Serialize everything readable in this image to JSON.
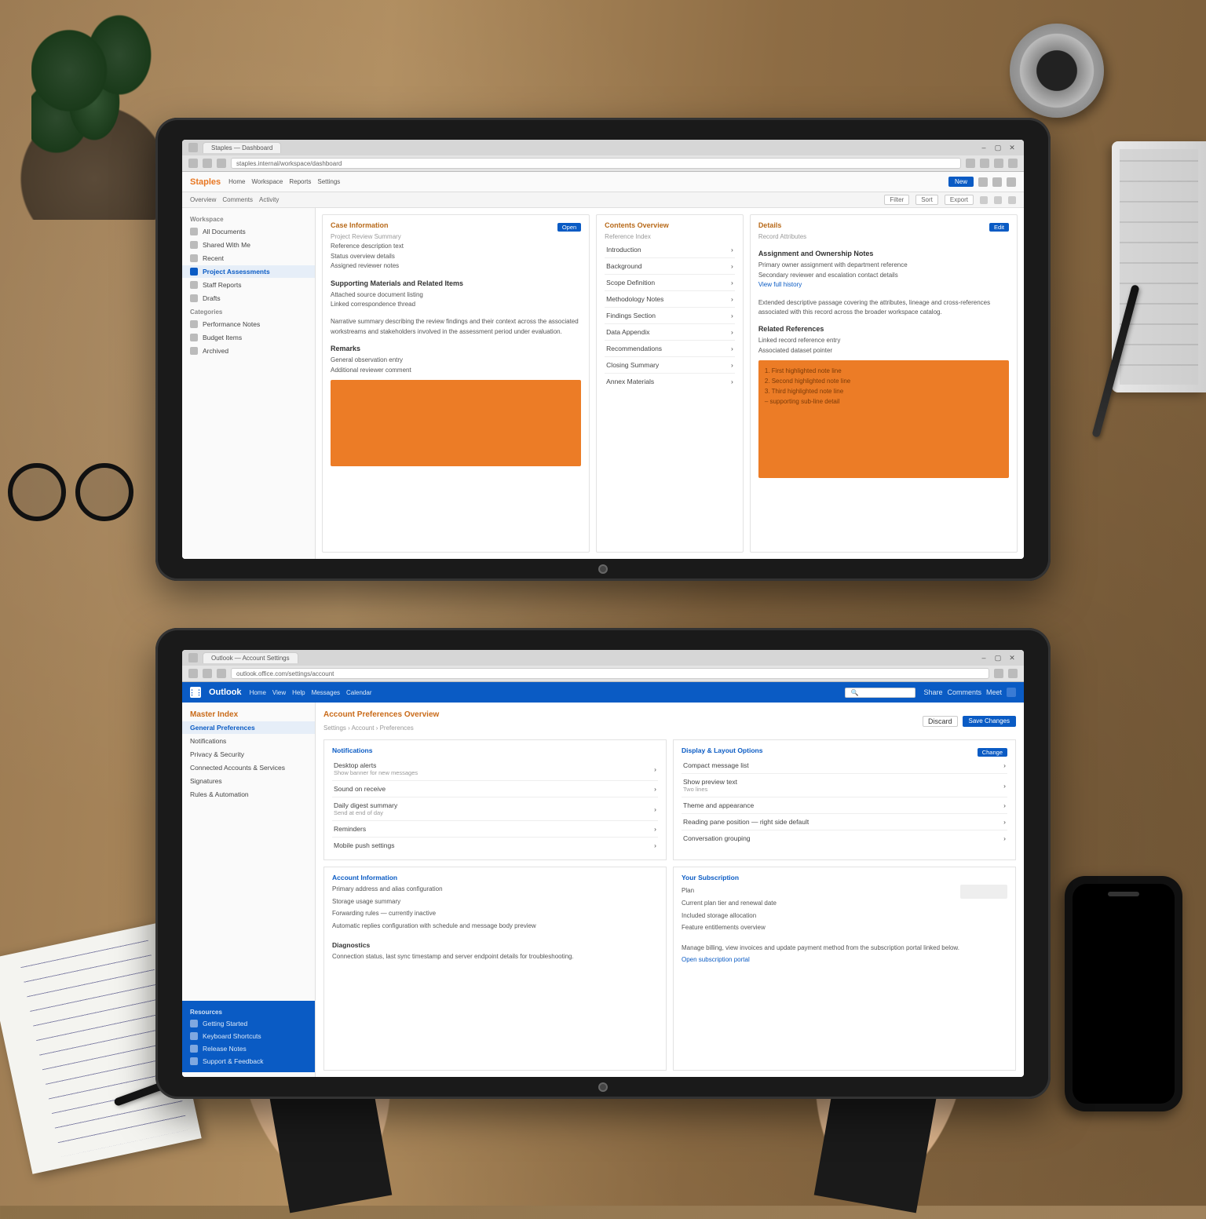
{
  "colors": {
    "orange": "#ec7c26",
    "blue": "#0a5bc4"
  },
  "deviceTop": {
    "browser": {
      "tab": "Staples — Dashboard",
      "url": "staples.internal/workspace/dashboard",
      "title": "Staples Workspace"
    },
    "brand": "Staples",
    "toolbar": [
      "Home",
      "Workspace",
      "Reports",
      "Settings"
    ],
    "toolbar2": {
      "items": [
        "Overview",
        "Comments",
        "Activity"
      ],
      "rightItems": [
        "Filter",
        "Sort",
        "Export"
      ]
    },
    "headerButton": "New",
    "sidebar": {
      "section1": "Workspace",
      "items1": [
        "All Documents",
        "Shared With Me",
        "Recent",
        "Project Assessments",
        "Staff Reports",
        "Drafts"
      ],
      "section2": "Categories",
      "items2": [
        "Performance Notes",
        "Budget Items",
        "Archived"
      ]
    },
    "col1": {
      "title": "Case Information",
      "sub": "Project Review Summary",
      "rows": [
        "Reference description text",
        "Status overview details",
        "Assigned reviewer notes"
      ],
      "button": "Open",
      "heading2": "Supporting Materials and Related Items",
      "bullets": [
        "Attached source document listing",
        "Linked correspondence thread"
      ],
      "para": "Narrative summary describing the review findings and their context across the associated workstreams and stakeholders involved in the assessment period under evaluation.",
      "heading3": "Remarks",
      "remarks": [
        "General observation entry",
        "Additional reviewer comment"
      ],
      "orangeLines": ""
    },
    "col2": {
      "title": "Contents Overview",
      "sub": "Reference Index",
      "items": [
        "Introduction",
        "Background",
        "Scope Definition",
        "Methodology Notes",
        "Findings Section",
        "Data Appendix",
        "Recommendations",
        "Closing Summary",
        "Annex Materials"
      ]
    },
    "col3": {
      "title": "Details",
      "sub": "Record Attributes",
      "button": "Edit",
      "heading2": "Assignment and Ownership Notes",
      "rows": [
        "Primary owner assignment with department reference",
        "Secondary reviewer and escalation contact details"
      ],
      "link": "View full history",
      "para": "Extended descriptive passage covering the attributes, lineage and cross-references associated with this record across the broader workspace catalog.",
      "heading3": "Related References",
      "refs": [
        "Linked record reference entry",
        "Associated dataset pointer"
      ],
      "orangeLines": [
        "1. First highlighted note line",
        "2. Second highlighted note line",
        "3. Third highlighted note line",
        "   – supporting sub-line detail"
      ]
    }
  },
  "deviceBottom": {
    "browser": {
      "tab": "Outlook — Account Settings",
      "url": "outlook.office.com/settings/account",
      "title": "Outlook Settings"
    },
    "brand": "Outlook",
    "toolbar": [
      "Home",
      "View",
      "Help",
      "Messages",
      "Calendar"
    ],
    "searchPlaceholder": "Search",
    "headerRight": [
      "Share",
      "Comments",
      "Meet"
    ],
    "pageTitle": "Account Preferences Overview",
    "breadcrumb": "Settings › Account › Preferences",
    "actionPrimary": "Save Changes",
    "actionSecondary": "Discard",
    "sidebar": {
      "title": "Master Index",
      "active": "General Preferences",
      "items": [
        "General Preferences",
        "Notifications",
        "Privacy & Security",
        "Connected Accounts & Services",
        "Signatures",
        "Rules & Automation"
      ],
      "blueTitle": "Resources",
      "blueItems": [
        "Getting Started",
        "Keyboard Shortcuts",
        "Release Notes",
        "Support & Feedback"
      ]
    },
    "upper": {
      "left": {
        "title": "Notifications",
        "items": [
          {
            "label": "Desktop alerts",
            "sub": "Show banner for new messages"
          },
          {
            "label": "Sound on receive",
            "sub": ""
          },
          {
            "label": "Daily digest summary",
            "sub": "Send at end of day"
          },
          {
            "label": "Reminders",
            "sub": ""
          },
          {
            "label": "Mobile push settings",
            "sub": ""
          }
        ]
      },
      "right": {
        "title": "Display & Layout Options",
        "items": [
          {
            "label": "Compact message list",
            "sub": ""
          },
          {
            "label": "Show preview text",
            "sub": "Two lines"
          },
          {
            "label": "Theme and appearance",
            "sub": ""
          },
          {
            "label": "Reading pane position — right side default",
            "sub": ""
          },
          {
            "label": "Conversation grouping",
            "sub": ""
          }
        ],
        "button": "Change"
      }
    },
    "lower": {
      "left": {
        "title": "Account Information",
        "rows": [
          "Primary address and alias configuration",
          "Storage usage summary",
          "Forwarding rules — currently inactive",
          "Automatic replies configuration with schedule and message body preview"
        ],
        "heading2": "Diagnostics",
        "diag": "Connection status, last sync timestamp and server endpoint details for troubleshooting."
      },
      "right": {
        "title": "Your Subscription",
        "rowLabel": "Plan",
        "rows": [
          "Current plan tier and renewal date",
          "Included storage allocation",
          "Feature entitlements overview"
        ],
        "para": "Manage billing, view invoices and update payment method from the subscription portal linked below.",
        "link": "Open subscription portal"
      }
    }
  }
}
